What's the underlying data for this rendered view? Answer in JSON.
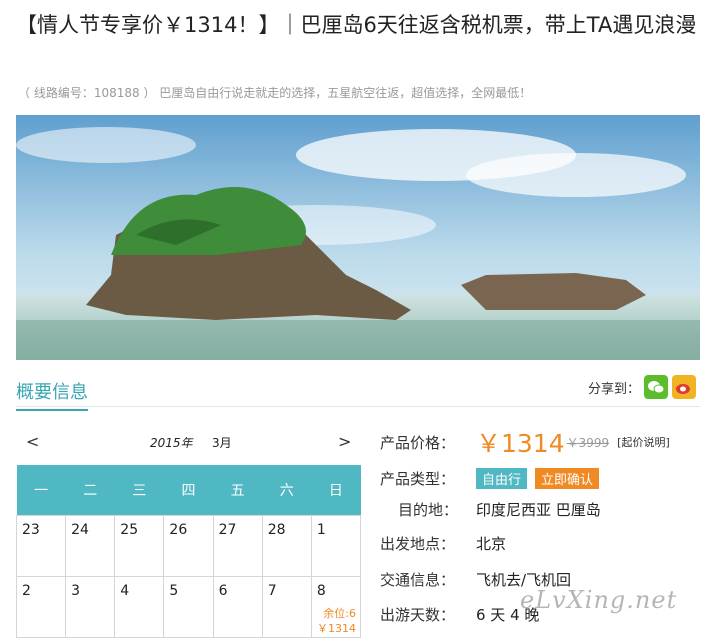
{
  "product": {
    "title": "【情人节专享价￥1314！】｜巴厘岛6天往返含税机票，带上TA遇见浪漫",
    "subline": "（ 线路编号：108188 ） 巴厘岛自由行说走就走的选择，五星航空往返，超值选择，全网最低！"
  },
  "section": {
    "title": "概要信息",
    "share_label": "分享到："
  },
  "share": {
    "wechat_icon": "wechat-icon",
    "weibo_icon": "weibo-icon"
  },
  "calendar": {
    "prev": "<",
    "next": ">",
    "year": "2015年",
    "month": "3月",
    "weekdays": [
      "一",
      "二",
      "三",
      "四",
      "五",
      "六",
      "日"
    ],
    "week1": [
      "23",
      "24",
      "25",
      "26",
      "27",
      "28",
      "1"
    ],
    "week2": [
      "2",
      "3",
      "4",
      "5",
      "6",
      "7",
      "8"
    ],
    "avail_label": "余位:6",
    "avail_price": "￥1314"
  },
  "info": {
    "price_label": "产品价格：",
    "price": "￥1314",
    "orig_price": "￥3999",
    "price_note": "[起价说明]",
    "type_label": "产品类型：",
    "tag1": "自由行",
    "tag2": "立即确认",
    "dest_label": "目的地：",
    "dest": "印度尼西亚 巴厘岛",
    "depart_label": "出发地点：",
    "depart": "北京",
    "transport_label": "交通信息：",
    "transport": "飞机去/飞机回",
    "days_label": "出游天数：",
    "days": "6 天 4 晚"
  },
  "watermark": "eLvXing.net",
  "colors": {
    "accent": "#4fb8c3",
    "orange": "#f08a24"
  }
}
